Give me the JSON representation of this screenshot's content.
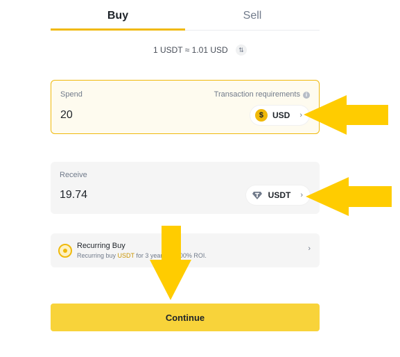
{
  "tabs": {
    "buy": "Buy",
    "sell": "Sell",
    "active": "Buy"
  },
  "rate": {
    "text": "1 USDT ≈ 1.01 USD",
    "icon": "swap-icon"
  },
  "spend": {
    "label": "Spend",
    "requirements": "Transaction requirements",
    "info_icon": "i",
    "value": "20",
    "currency": "USD",
    "currency_icon": "dollar-coin-icon",
    "coin_glyph": "$",
    "chevron": "›"
  },
  "receive": {
    "label": "Receive",
    "value": "19.74",
    "currency": "USDT",
    "currency_icon": "tether-coin-icon",
    "chevron": "›"
  },
  "recurring": {
    "title": "Recurring Buy",
    "subtitle_before": "Recurring buy ",
    "subtitle_highlight": "USDT",
    "subtitle_after": " for 3 years to 0.00% ROI.",
    "chevron": "›"
  },
  "continue_label": "Continue",
  "colors": {
    "accent": "#f0b90b",
    "button": "#f8d33a",
    "annotation_arrow": "#ffcc00",
    "text": "#1e2329",
    "muted": "#707a8a"
  }
}
